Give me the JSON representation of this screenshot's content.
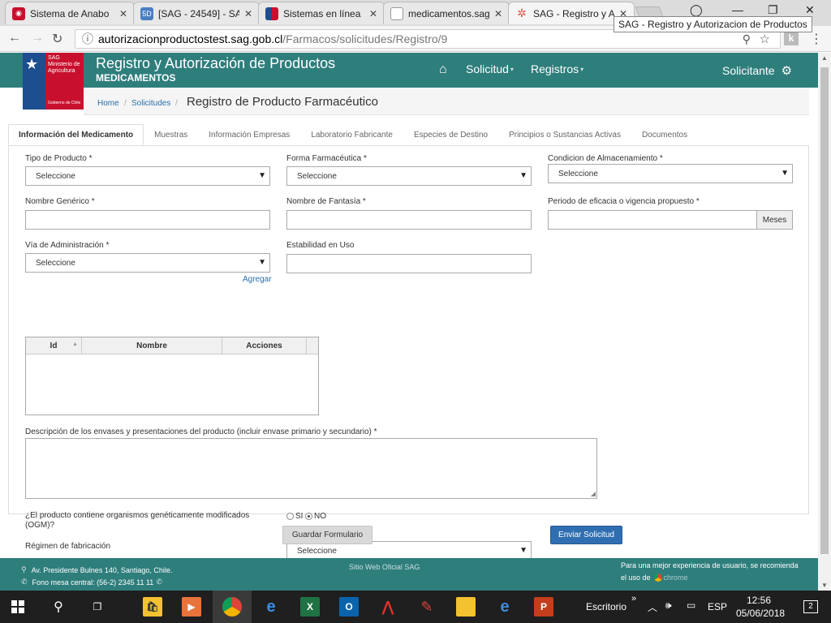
{
  "browser": {
    "tabs": [
      {
        "title": "Sistema de Anabo",
        "favicon_color": "#c8102e",
        "favicon_glyph": "◉"
      },
      {
        "title": "[SAG - 24549] - SA",
        "favicon_color": "#4a7fc1",
        "favicon_glyph": "5D"
      },
      {
        "title": "Sistemas en línea",
        "favicon_color": "#c8102e",
        "favicon_glyph": "▮"
      },
      {
        "title": "medicamentos.sag",
        "favicon_color": "#9e9e9e",
        "favicon_glyph": "▯"
      },
      {
        "title": "SAG - Registro y A",
        "favicon_color": "#e05a4f",
        "favicon_glyph": "✲",
        "active": true
      }
    ],
    "tooltip": "SAG - Registro y Autorizacion de Productos",
    "url_host": "autorizacionproductostest.sag.gob.cl",
    "url_path": "/Farmacos/solicitudes/Registro/9",
    "window_controls": {
      "minimize": "—",
      "maximize": "❐",
      "close": "✕"
    }
  },
  "header": {
    "logo_text": "SAG Ministerio de Agricultura",
    "logo_footer": "Gobierno de Chile",
    "title": "Registro y Autorización de Productos",
    "subtitle": "MEDICAMENTOS",
    "nav": {
      "solicitud": "Solicitud",
      "registros": "Registros",
      "user": "Solicitante"
    }
  },
  "breadcrumb": {
    "home": "Home",
    "solicitudes": "Solicitudes",
    "current": "Registro de Producto Farmacéutico"
  },
  "form_tabs": [
    "Información del Medicamento",
    "Muestras",
    "Información Empresas",
    "Laboratorio Fabricante",
    "Especies de Destino",
    "Principios o Sustancias Activas",
    "Documentos"
  ],
  "form": {
    "tipo_producto": {
      "label": "Tipo de Producto *",
      "value": "Seleccione"
    },
    "forma_farmaceutica": {
      "label": "Forma Farmacéutica *",
      "value": "Seleccione"
    },
    "condicion_almacenamiento": {
      "label": "Condicion de Almacenamiento *",
      "value": "Seleccione"
    },
    "nombre_generico": {
      "label": "Nombre Genérico *"
    },
    "nombre_fantasia": {
      "label": "Nombre de Fantasía *"
    },
    "periodo_eficacia": {
      "label": "Periodo de eficacia o vigencia propuesto *",
      "addon": "Meses"
    },
    "via_administracion": {
      "label": "Vía de Administración *",
      "value": "Seleccione"
    },
    "estabilidad_uso": {
      "label": "Estabilidad en Uso"
    },
    "add_link": "Agregar",
    "grid_columns": {
      "id": "Id",
      "nombre": "Nombre",
      "acciones": "Acciones"
    },
    "descripcion_envases": {
      "label": "Descripción de los envases y presentaciones del producto (incluir envase primario y secundario) *"
    },
    "ogm": {
      "label_line1": "¿El producto contiene organismos genéticamente modificados",
      "label_line2": "(OGM)?",
      "si": "SI",
      "no": "NO",
      "selected": "NO"
    },
    "regimen_fabricacion": {
      "label": "Régimen de fabricación",
      "value": "Seleccione"
    }
  },
  "actions": {
    "save": "Guardar Formulario",
    "send": "Enviar Solicitud"
  },
  "footer": {
    "address": "Av. Presidente Bulnes 140, Santiago, Chile.",
    "phone": "Fono mesa central: (56-2) 2345 11 11",
    "site": "Sitio Web Oficial SAG",
    "reco_line1": "Para una mejor experiencia de usuario, se recomienda",
    "reco_line2": "el uso de",
    "browser_name": "chrome"
  },
  "taskbar": {
    "desktop_label": "Escritorio",
    "lang": "ESP",
    "time": "12:56",
    "date": "05/06/2018",
    "notifications": "2"
  },
  "colors": {
    "header": "#2e7e7c",
    "accent_blue": "#2f6fb1",
    "gov_blue": "#1d4e8f",
    "gov_red": "#c8102e"
  }
}
